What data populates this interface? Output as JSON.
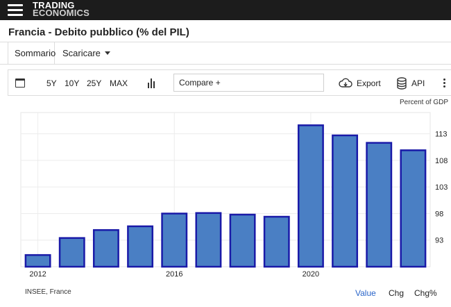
{
  "header": {
    "logo_line1": "TRADING",
    "logo_line2": "ECONOMICS"
  },
  "page": {
    "title": "Francia - Debito pubblico (% del PIL)"
  },
  "tabs": [
    {
      "label": "Sommario",
      "active": true
    },
    {
      "label": "Scaricare",
      "has_dropdown": true
    }
  ],
  "toolbar": {
    "ranges": [
      "5Y",
      "10Y",
      "25Y",
      "MAX"
    ],
    "compare_label": "Compare +",
    "export_label": "Export",
    "api_label": "API"
  },
  "chart_data": {
    "type": "bar",
    "unit_label": "Percent of GDP",
    "categories": [
      "2012",
      "2013",
      "2014",
      "2015",
      "2016",
      "2017",
      "2018",
      "2019",
      "2020",
      "2021",
      "2022",
      "2023"
    ],
    "x_tick_labels": [
      "2012",
      "2016",
      "2020"
    ],
    "values": [
      90.2,
      93.4,
      94.9,
      95.6,
      98.0,
      98.1,
      97.8,
      97.4,
      114.6,
      112.7,
      111.3,
      109.9
    ],
    "ylim": [
      88,
      117
    ],
    "y_ticks": [
      93,
      98,
      103,
      108,
      113
    ],
    "bar_color": "#4a7fc4",
    "bar_border": "#1a1aa8",
    "grid": true
  },
  "footer": {
    "source": "INSEE, France",
    "modes": [
      "Value",
      "Chg",
      "Chg%"
    ],
    "active_mode": "Value"
  },
  "colors": {
    "topbar": "#1c1c1c",
    "link": "#2a65c9"
  }
}
